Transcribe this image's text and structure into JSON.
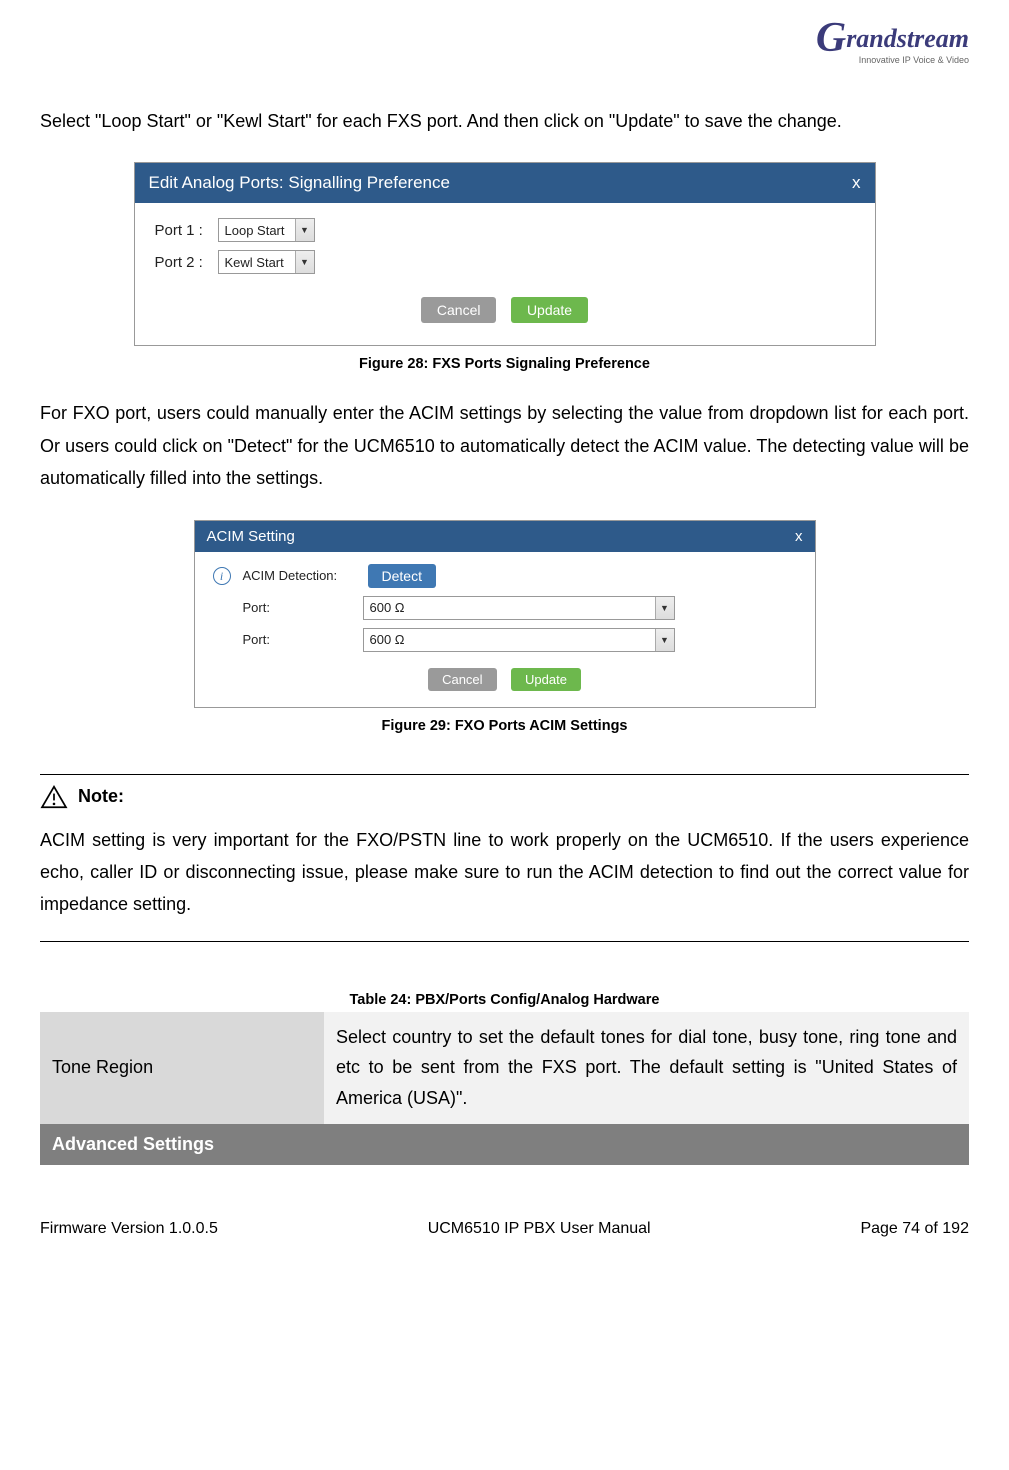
{
  "logo": {
    "brand_initial": "G",
    "brand_rest": "randstream",
    "tagline": "Innovative IP Voice & Video"
  },
  "para1": "Select \"Loop Start\" or \"Kewl Start\" for each FXS port. And then click on \"Update\" to save the change.",
  "dlg1": {
    "title": "Edit Analog Ports: Signalling Preference",
    "close": "x",
    "port1_label": "Port 1 :",
    "port1_value": "Loop Start",
    "port2_label": "Port 2 :",
    "port2_value": "Kewl Start",
    "cancel": "Cancel",
    "update": "Update"
  },
  "caption1": "Figure 28: FXS Ports Signaling Preference",
  "para2": "For FXO port, users could manually enter the ACIM settings by selecting the value from dropdown list for each port. Or users could click on \"Detect\" for the UCM6510 to automatically detect the ACIM value. The detecting value will be automatically filled into the settings.",
  "dlg2": {
    "title": "ACIM Setting",
    "close": "x",
    "row1_label": "ACIM Detection:",
    "detect": "Detect",
    "row2_label": "Port:",
    "row2_value": "600 Ω",
    "row3_label": "Port:",
    "row3_value": "600 Ω",
    "cancel": "Cancel",
    "update": "Update"
  },
  "caption2": "Figure 29: FXO Ports ACIM Settings",
  "note_title": "Note:",
  "note_body": "ACIM setting is very important for the FXO/PSTN line to work properly on the UCM6510. If the users experience echo, caller ID or disconnecting issue, please make sure to run the ACIM detection to find out the correct value for impedance setting.",
  "table_caption": "Table 24: PBX/Ports Config/Analog Hardware",
  "table": {
    "r1c1": "Tone Region",
    "r1c2": "Select country to set the default tones for dial tone, busy tone, ring tone and etc to be sent from the FXS port. The default setting is \"United States of America (USA)\".",
    "r2": "Advanced Settings"
  },
  "footer": {
    "left": "Firmware Version 1.0.0.5",
    "mid": "UCM6510 IP PBX User Manual",
    "right": "Page 74 of 192"
  }
}
